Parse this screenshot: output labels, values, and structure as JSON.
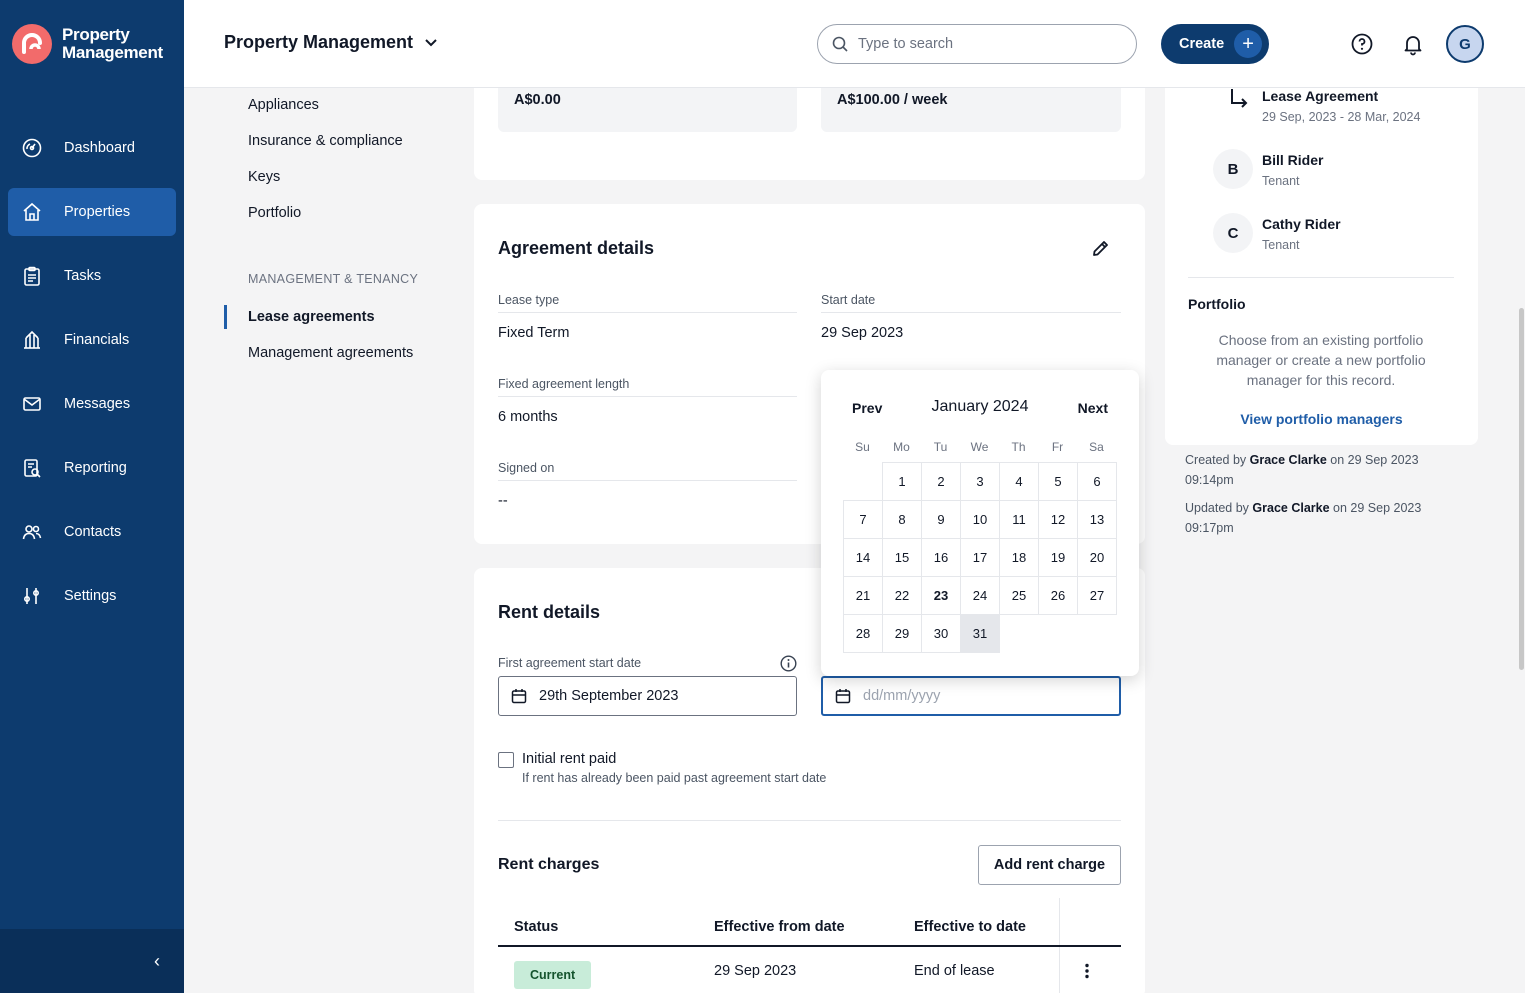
{
  "app": {
    "brand_line1": "Property",
    "brand_line2": "Management"
  },
  "header": {
    "title": "Property Management",
    "search_placeholder": "Type to search",
    "create_label": "Create",
    "avatar_initial": "G"
  },
  "sidebar": {
    "items": [
      {
        "label": "Dashboard",
        "icon": "gauge-icon"
      },
      {
        "label": "Properties",
        "icon": "home-icon",
        "active": true
      },
      {
        "label": "Tasks",
        "icon": "clipboard-icon"
      },
      {
        "label": "Financials",
        "icon": "bank-icon"
      },
      {
        "label": "Messages",
        "icon": "mail-icon"
      },
      {
        "label": "Reporting",
        "icon": "report-icon"
      },
      {
        "label": "Contacts",
        "icon": "people-icon"
      },
      {
        "label": "Settings",
        "icon": "sliders-icon"
      }
    ]
  },
  "subnav": {
    "items_top": [
      "Appliances",
      "Insurance & compliance",
      "Keys",
      "Portfolio"
    ],
    "section_heading": "MANAGEMENT & TENANCY",
    "items_bottom": [
      "Lease agreements",
      "Management agreements"
    ]
  },
  "amounts": {
    "left": "A$0.00",
    "right": "A$100.00 / week"
  },
  "agreement": {
    "title": "Agreement details",
    "lease_type_label": "Lease type",
    "lease_type_value": "Fixed Term",
    "start_date_label": "Start date",
    "start_date_value": "29 Sep 2023",
    "fixed_length_label": "Fixed agreement length",
    "fixed_length_value": "6 months",
    "signed_on_label": "Signed on",
    "signed_on_value": "--"
  },
  "calendar": {
    "prev": "Prev",
    "next": "Next",
    "month": "January 2024",
    "weekdays": [
      "Su",
      "Mo",
      "Tu",
      "We",
      "Th",
      "Fr",
      "Sa"
    ],
    "first_weekday_offset": 1,
    "days_in_month": 31,
    "today": 23,
    "hovered": 31
  },
  "rent": {
    "title": "Rent details",
    "first_start_label": "First agreement start date",
    "first_start_value": "29th September 2023",
    "second_date_placeholder": "dd/mm/yyyy",
    "initial_paid_label": "Initial rent paid",
    "initial_paid_help": "If rent has already been paid past agreement start date",
    "initial_paid_checked": false,
    "charges_title": "Rent charges",
    "add_charge_label": "Add rent charge",
    "table": {
      "headers": [
        "Status",
        "Effective from date",
        "Effective to date"
      ],
      "rows": [
        {
          "status": "Current",
          "from": "29 Sep 2023",
          "to": "End of lease"
        }
      ]
    }
  },
  "right_panel": {
    "lease_title": "Lease Agreement",
    "lease_dates": "29 Sep, 2023 - 28 Mar, 2024",
    "tenants": [
      {
        "initial": "B",
        "name": "Bill Rider",
        "role": "Tenant"
      },
      {
        "initial": "C",
        "name": "Cathy Rider",
        "role": "Tenant"
      }
    ],
    "portfolio_title": "Portfolio",
    "portfolio_text": "Choose from an existing portfolio manager or create a new portfolio manager for this record.",
    "portfolio_link": "View portfolio managers"
  },
  "meta": {
    "created_prefix": "Created by",
    "created_by": "Grace Clarke",
    "created_on": "on 29 Sep 2023",
    "created_time": "09:14pm",
    "updated_prefix": "Updated by",
    "updated_by": "Grace Clarke",
    "updated_on": "on 29 Sep 2023",
    "updated_time": "09:17pm"
  }
}
